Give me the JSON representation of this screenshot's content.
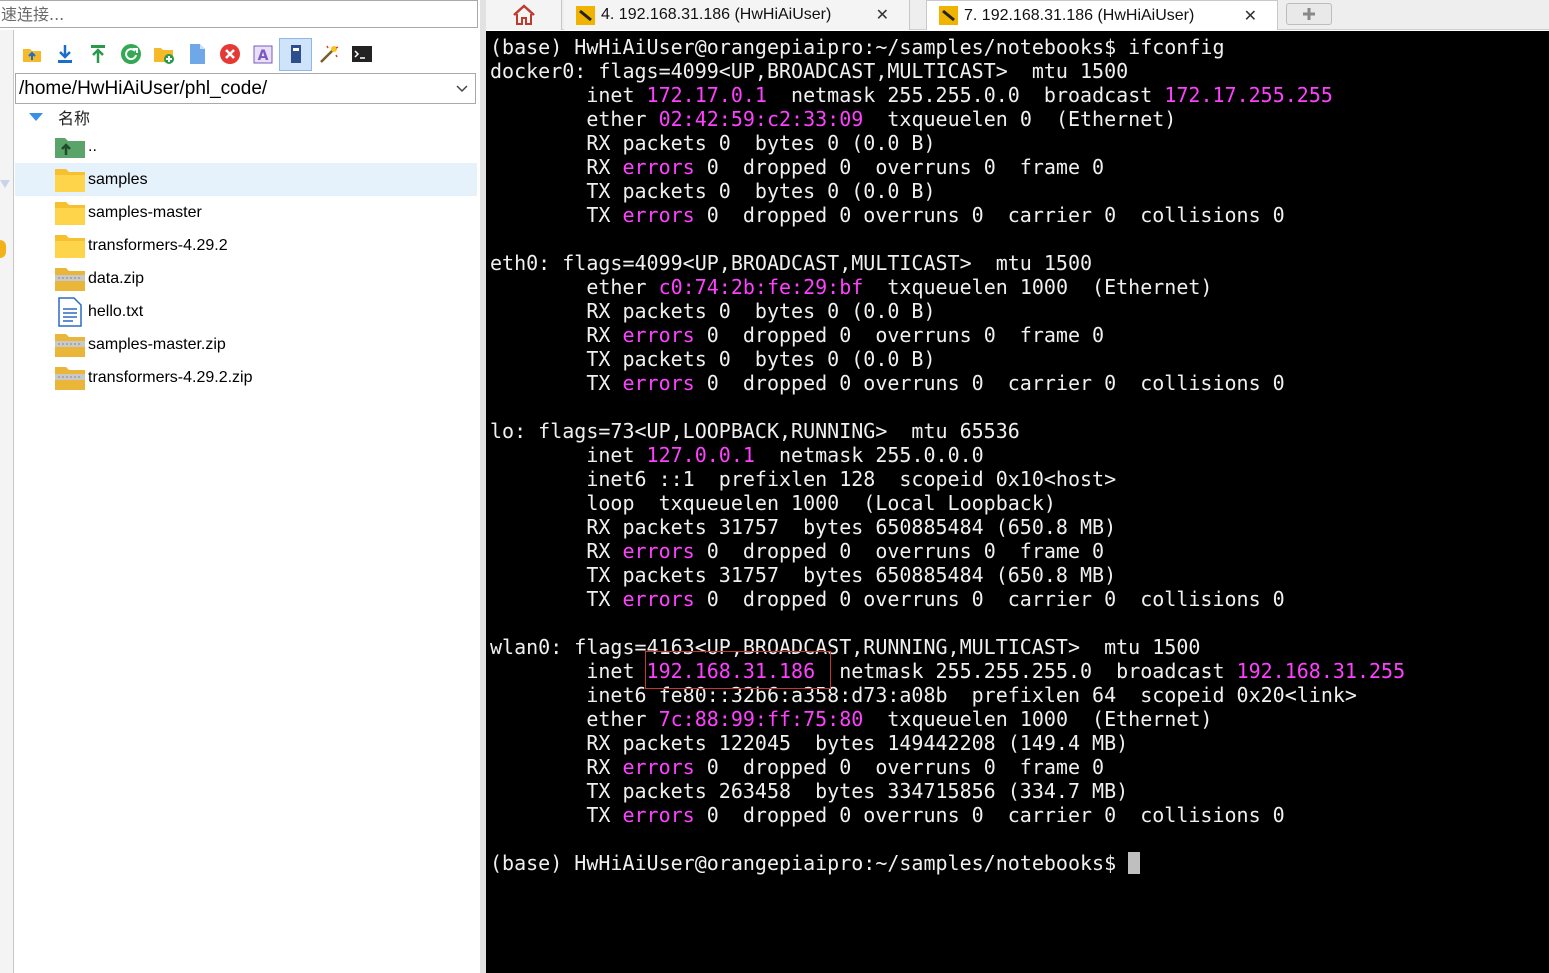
{
  "quick_connect": {
    "placeholder": "速连接..."
  },
  "toolbar": {
    "icons": [
      "folder-up-icon",
      "download-icon",
      "upload-icon",
      "refresh-icon",
      "new-folder-icon",
      "new-file-icon",
      "delete-icon",
      "rename-icon",
      "view-icon",
      "magic-wand-icon",
      "terminal-icon"
    ]
  },
  "path": {
    "value": "/home/HwHiAiUser/phl_code/"
  },
  "file_list": {
    "column_name": "名称",
    "items": [
      {
        "name": "..",
        "icon": "parent-folder-icon"
      },
      {
        "name": "samples",
        "icon": "folder-icon",
        "selected": true
      },
      {
        "name": "samples-master",
        "icon": "folder-icon"
      },
      {
        "name": "transformers-4.29.2",
        "icon": "folder-icon"
      },
      {
        "name": "data.zip",
        "icon": "zip-icon"
      },
      {
        "name": "hello.txt",
        "icon": "text-file-icon"
      },
      {
        "name": "samples-master.zip",
        "icon": "zip-icon"
      },
      {
        "name": "transformers-4.29.2.zip",
        "icon": "zip-icon"
      }
    ]
  },
  "tabs": {
    "home_icon": "home-icon",
    "tab1_label": "4. 192.168.31.186 (HwHiAiUser)",
    "tab2_label": "7. 192.168.31.186 (HwHiAiUser)",
    "close_label": "✕",
    "new_tab_icon": "plus-icon"
  },
  "colors": {
    "highlight": "#ff40ff",
    "terminal_bg": "#000000",
    "terminal_fg": "#f0f0f0",
    "selection": "#e5f1fb"
  },
  "terminal": {
    "lines": [
      [
        [
          "(base) HwHiAiUser@orangepiaipro:~/samples/notebooks$ ifconfig",
          false
        ]
      ],
      [
        [
          "docker0: flags=4099<UP,BROADCAST,MULTICAST>  mtu 1500",
          false
        ]
      ],
      [
        [
          "        inet ",
          false
        ],
        [
          "172.17.0.1",
          true
        ],
        [
          "  netmask 255.255.0.0  broadcast ",
          false
        ],
        [
          "172.17.255.255",
          true
        ]
      ],
      [
        [
          "        ether ",
          false
        ],
        [
          "02:42:59:c2:33:09",
          true
        ],
        [
          "  txqueuelen 0  (Ethernet)",
          false
        ]
      ],
      [
        [
          "        RX packets 0  bytes 0 (0.0 B)",
          false
        ]
      ],
      [
        [
          "        RX ",
          false
        ],
        [
          "errors",
          true
        ],
        [
          " 0  dropped 0  overruns 0  frame 0",
          false
        ]
      ],
      [
        [
          "        TX packets 0  bytes 0 (0.0 B)",
          false
        ]
      ],
      [
        [
          "        TX ",
          false
        ],
        [
          "errors",
          true
        ],
        [
          " 0  dropped 0 overruns 0  carrier 0  collisions 0",
          false
        ]
      ],
      [
        [
          "",
          false
        ]
      ],
      [
        [
          "eth0: flags=4099<UP,BROADCAST,MULTICAST>  mtu 1500",
          false
        ]
      ],
      [
        [
          "        ether ",
          false
        ],
        [
          "c0:74:2b:fe:29:bf",
          true
        ],
        [
          "  txqueuelen 1000  (Ethernet)",
          false
        ]
      ],
      [
        [
          "        RX packets 0  bytes 0 (0.0 B)",
          false
        ]
      ],
      [
        [
          "        RX ",
          false
        ],
        [
          "errors",
          true
        ],
        [
          " 0  dropped 0  overruns 0  frame 0",
          false
        ]
      ],
      [
        [
          "        TX packets 0  bytes 0 (0.0 B)",
          false
        ]
      ],
      [
        [
          "        TX ",
          false
        ],
        [
          "errors",
          true
        ],
        [
          " 0  dropped 0 overruns 0  carrier 0  collisions 0",
          false
        ]
      ],
      [
        [
          "",
          false
        ]
      ],
      [
        [
          "lo: flags=73<UP,LOOPBACK,RUNNING>  mtu 65536",
          false
        ]
      ],
      [
        [
          "        inet ",
          false
        ],
        [
          "127.0.0.1",
          true
        ],
        [
          "  netmask 255.0.0.0",
          false
        ]
      ],
      [
        [
          "        inet6 ::1  prefixlen 128  scopeid 0x10<host>",
          false
        ]
      ],
      [
        [
          "        loop  txqueuelen 1000  (Local Loopback)",
          false
        ]
      ],
      [
        [
          "        RX packets 31757  bytes 650885484 (650.8 MB)",
          false
        ]
      ],
      [
        [
          "        RX ",
          false
        ],
        [
          "errors",
          true
        ],
        [
          " 0  dropped 0  overruns 0  frame 0",
          false
        ]
      ],
      [
        [
          "        TX packets 31757  bytes 650885484 (650.8 MB)",
          false
        ]
      ],
      [
        [
          "        TX ",
          false
        ],
        [
          "errors",
          true
        ],
        [
          " 0  dropped 0 overruns 0  carrier 0  collisions 0",
          false
        ]
      ],
      [
        [
          "",
          false
        ]
      ],
      [
        [
          "wlan0: flags=4163<UP,BROADCAST,RUNNING,MULTICAST>  mtu 1500",
          false
        ]
      ],
      [
        [
          "        inet ",
          false
        ],
        [
          "192.168.31.186",
          true
        ],
        [
          "  netmask 255.255.255.0  broadcast ",
          false
        ],
        [
          "192.168.31.255",
          true
        ]
      ],
      [
        [
          "        inet6 fe80::32b6:a358:d73:a08b  prefixlen 64  scopeid 0x20<link>",
          false
        ]
      ],
      [
        [
          "        ether ",
          false
        ],
        [
          "7c:88:99:ff:75:80",
          true
        ],
        [
          "  txqueuelen 1000  (Ethernet)",
          false
        ]
      ],
      [
        [
          "        RX packets 122045  bytes 149442208 (149.4 MB)",
          false
        ]
      ],
      [
        [
          "        RX ",
          false
        ],
        [
          "errors",
          true
        ],
        [
          " 0  dropped 0  overruns 0  frame 0",
          false
        ]
      ],
      [
        [
          "        TX packets 263458  bytes 334715856 (334.7 MB)",
          false
        ]
      ],
      [
        [
          "        TX ",
          false
        ],
        [
          "errors",
          true
        ],
        [
          " 0  dropped 0 overruns 0  carrier 0  collisions 0",
          false
        ]
      ],
      [
        [
          "",
          false
        ]
      ],
      [
        [
          "(base) HwHiAiUser@orangepiaipro:~/samples/notebooks$ ",
          false
        ]
      ]
    ]
  }
}
